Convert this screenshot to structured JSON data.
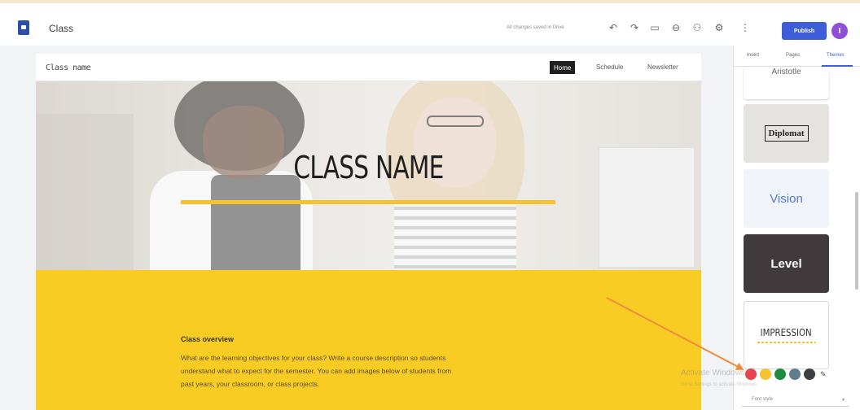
{
  "app": {
    "title": "Class",
    "save_status": "All changes saved in Drive",
    "publish_label": "Publish",
    "avatar_initial": "I"
  },
  "toolbar": {
    "undo_icon": "undo-icon",
    "redo_icon": "redo-icon",
    "preview_icon": "preview-icon",
    "link_icon": "link-icon",
    "share_icon": "add-person-icon",
    "settings_icon": "gear-icon",
    "more_icon": "more-vert-icon"
  },
  "site": {
    "name": "Class name",
    "nav": [
      "Home",
      "Schedule",
      "Newsletter"
    ],
    "hero_title": "CLASS NAME",
    "overview_heading": "Class overview",
    "overview_lines": [
      "What are the learning objectives for your class? Write a course description so students",
      "understand what to expect for the semester. You can add images below of students from",
      "past years, your classroom, or class projects."
    ]
  },
  "panel": {
    "tabs": [
      "Insert",
      "Pages",
      "Themes"
    ],
    "active_tab": "Themes",
    "themes": [
      "Aristotle",
      "Diplomat",
      "Vision",
      "Level",
      "IMPRESSION"
    ],
    "swatch_colors": [
      "#e8434f",
      "#f4c430",
      "#1e8e3e",
      "#5f7d8c",
      "#3c4043"
    ],
    "font_style_label": "Font style"
  },
  "colors": {
    "accent": "#3d5ed8",
    "hero_rule": "#f4c430",
    "overview_bg": "#f9cc24",
    "annotation_arrow": "#f08a3c"
  },
  "watermark": {
    "line1": "Activate Windows",
    "line2": "Go to Settings to activate Windows."
  }
}
